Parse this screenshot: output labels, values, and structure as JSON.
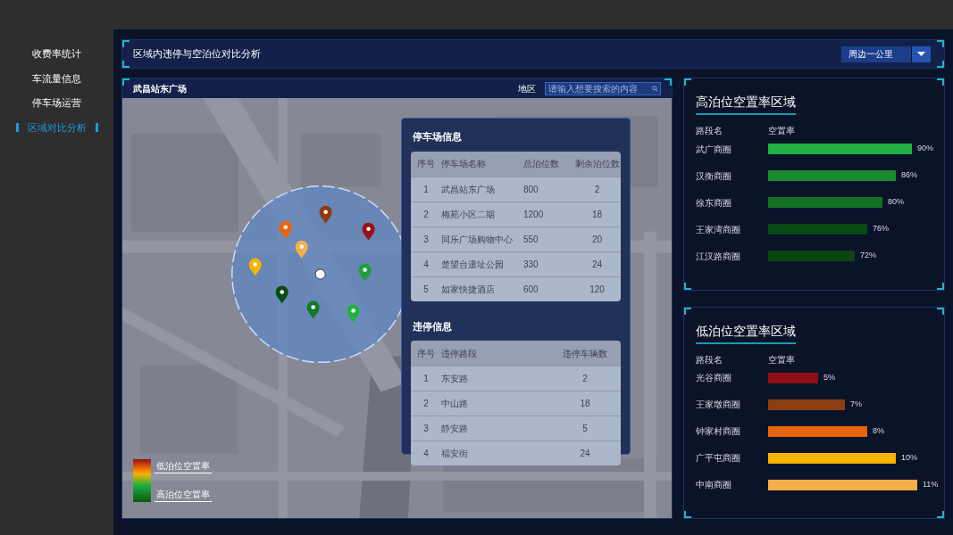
{
  "sidebar": {
    "items": [
      {
        "label": "收费率统计",
        "selected": false
      },
      {
        "label": "车流量信息",
        "selected": false
      },
      {
        "label": "停车场运营",
        "selected": false
      },
      {
        "label": "区域对比分析",
        "selected": true
      }
    ]
  },
  "header": {
    "title": "区域内违停与空泊位对比分析",
    "range_select": {
      "value": "周边一公里"
    }
  },
  "map_panel": {
    "title": "武昌站东广场",
    "region_label": "地区",
    "search": {
      "placeholder": "请输入想要搜索的内容"
    },
    "markers": [
      {
        "color": "#8b3a0f"
      },
      {
        "color": "#e8650a"
      },
      {
        "color": "#9b0e18"
      },
      {
        "color": "#f5b04a"
      },
      {
        "color": "#f5b400"
      },
      {
        "color": "#1f9e3a"
      },
      {
        "color": "#0b4a14"
      },
      {
        "color": "#137a26"
      },
      {
        "color": "#22b040"
      }
    ],
    "legend": {
      "top_label": "低泊位空置率",
      "bottom_label": "高泊位空置率"
    },
    "parking_info": {
      "title": "停车场信息",
      "columns": [
        "序号",
        "停车场名称",
        "总泊位数",
        "剩余泊位数"
      ],
      "rows": [
        [
          "1",
          "武昌站东广场",
          "800",
          "2"
        ],
        [
          "2",
          "梅苑小区二期",
          "1200",
          "18"
        ],
        [
          "3",
          "同乐广场购物中心",
          "550",
          "20"
        ],
        [
          "4",
          "楚望台遗址公园",
          "330",
          "24"
        ],
        [
          "5",
          "如家快捷酒店",
          "600",
          "120"
        ]
      ]
    },
    "violation_info": {
      "title": "违停信息",
      "columns": [
        "序号",
        "违停路段",
        "违停车辆数"
      ],
      "rows": [
        [
          "1",
          "东安路",
          "2"
        ],
        [
          "2",
          "中山路",
          "18"
        ],
        [
          "3",
          "静安路",
          "5"
        ],
        [
          "4",
          "福安街",
          "24"
        ]
      ]
    }
  },
  "high_panel": {
    "title": "高泊位空置率区域",
    "columns": [
      "路段名",
      "空置率"
    ],
    "rows": [
      {
        "name": "武广商圈",
        "reading": "90%",
        "color": "#22b040"
      },
      {
        "name": "汉衡商圈",
        "reading": "86%",
        "color": "#1a8a30"
      },
      {
        "name": "徐东商圈",
        "reading": "80%",
        "color": "#137024"
      },
      {
        "name": "王家湾商圈",
        "reading": "76%",
        "color": "#0a4a14"
      },
      {
        "name": "江汉路商圈",
        "reading": "72%",
        "color": "#0a4512"
      }
    ]
  },
  "low_panel": {
    "title": "低泊位空置率区域",
    "columns": [
      "路段名",
      "空置率"
    ],
    "rows": [
      {
        "name": "光谷商圈",
        "reading": "5%",
        "color": "#8e0e18"
      },
      {
        "name": "王家墩商圈",
        "reading": "7%",
        "color": "#8b3e10"
      },
      {
        "name": "钟家村商圈",
        "reading": "8%",
        "color": "#e8650a"
      },
      {
        "name": "广平屯商圈",
        "reading": "10%",
        "color": "#f5b400"
      },
      {
        "name": "中南商圈",
        "reading": "11%",
        "color": "#f5b04a"
      }
    ]
  }
}
